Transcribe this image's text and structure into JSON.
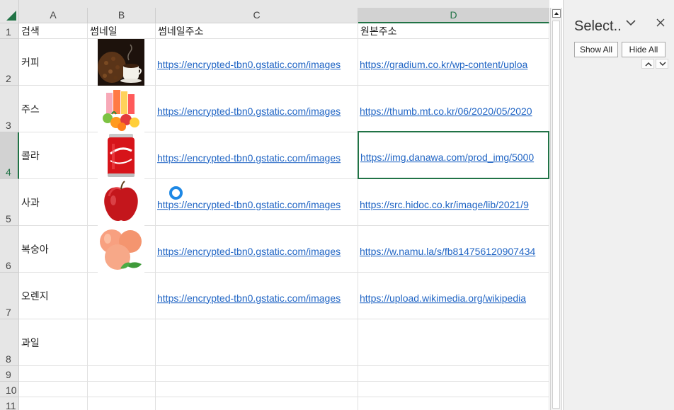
{
  "columns": [
    "A",
    "B",
    "C",
    "D"
  ],
  "rows": [
    "1",
    "2",
    "3",
    "4",
    "5",
    "6",
    "7",
    "8",
    "9",
    "10",
    "11"
  ],
  "headers": {
    "a": "검색",
    "b": "썸네일",
    "c": "썸네일주소",
    "d": "원본주소"
  },
  "data": [
    {
      "search": "커피",
      "thumb": "coffee-thumbnail",
      "thumb_url": "https://encrypted-tbn0.gstatic.com/images",
      "orig_url": "https://gradium.co.kr/wp-content/uploa"
    },
    {
      "search": "주스",
      "thumb": "juice-thumbnail",
      "thumb_url": "https://encrypted-tbn0.gstatic.com/images",
      "orig_url": "https://thumb.mt.co.kr/06/2020/05/2020"
    },
    {
      "search": "콜라",
      "thumb": "cola-thumbnail",
      "thumb_url": "https://encrypted-tbn0.gstatic.com/images",
      "orig_url": "https://img.danawa.com/prod_img/5000"
    },
    {
      "search": "사과",
      "thumb": "apple-thumbnail",
      "thumb_url": "https://encrypted-tbn0.gstatic.com/images",
      "orig_url": "https://src.hidoc.co.kr/image/lib/2021/9"
    },
    {
      "search": "복숭아",
      "thumb": "peach-thumbnail",
      "thumb_url": "https://encrypted-tbn0.gstatic.com/images",
      "orig_url": "https://w.namu.la/s/fb814756120907434"
    },
    {
      "search": "오렌지",
      "thumb": "",
      "thumb_url": "https://encrypted-tbn0.gstatic.com/images",
      "orig_url": "https://upload.wikimedia.org/wikipedia"
    },
    {
      "search": "과일",
      "thumb": "",
      "thumb_url": "",
      "orig_url": ""
    }
  ],
  "selection_pane": {
    "title": "Select..",
    "show_all": "Show All",
    "hide_all": "Hide All"
  },
  "colors": {
    "accent": "#217346",
    "link": "#1f64c4",
    "spinner": "#1e88e5"
  }
}
